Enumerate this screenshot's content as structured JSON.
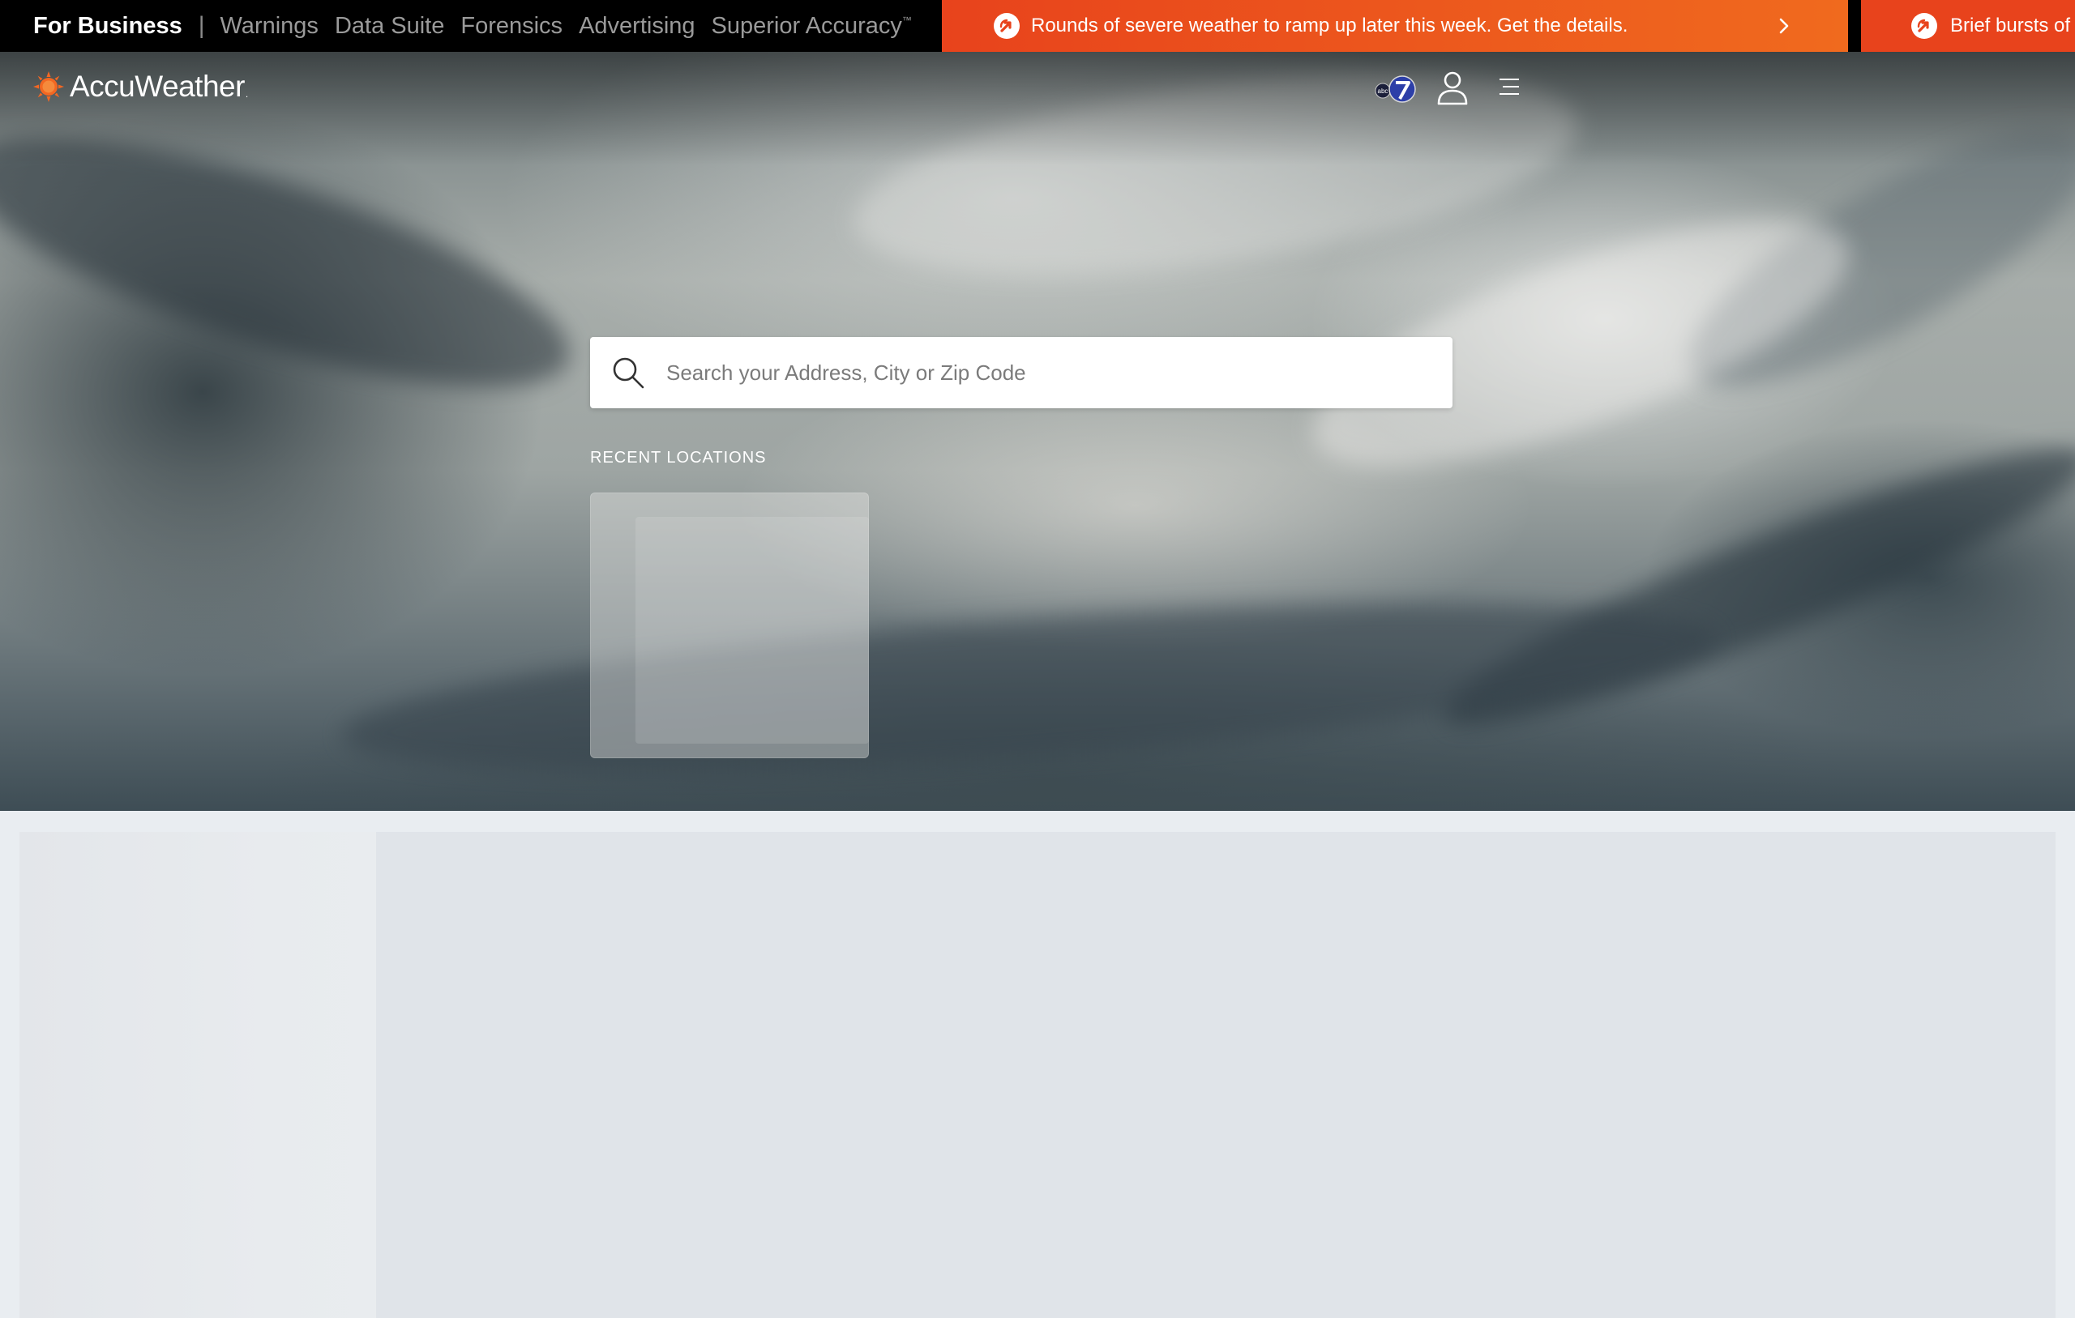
{
  "topbar": {
    "business_title": "For Business",
    "separator": "|",
    "links": [
      {
        "label": "Warnings"
      },
      {
        "label": "Data Suite"
      },
      {
        "label": "Forensics"
      },
      {
        "label": "Advertising"
      },
      {
        "label": "Superior Accuracy",
        "superscript": "™"
      }
    ]
  },
  "alerts": [
    {
      "text": "Rounds of severe weather to ramp up later this week. Get the details.",
      "icon": "alert-arrow-icon",
      "chevron": "chevron-right-icon"
    },
    {
      "text": "Brief bursts of",
      "icon": "alert-arrow-icon"
    }
  ],
  "header": {
    "logo_text": "AccuWeather",
    "logo_mark": ".",
    "partner_icon": "abc7-logo-icon",
    "account_icon": "user-icon",
    "menu_icon": "hamburger-menu-icon"
  },
  "search": {
    "placeholder": "Search your Address, City or Zip Code",
    "value": ""
  },
  "recent": {
    "heading": "RECENT LOCATIONS"
  },
  "colors": {
    "alert_orange": "#e8431c",
    "alert_orange_light": "#f06a1e",
    "brand_sun": "#f26722",
    "topbar_bg": "#000000"
  }
}
